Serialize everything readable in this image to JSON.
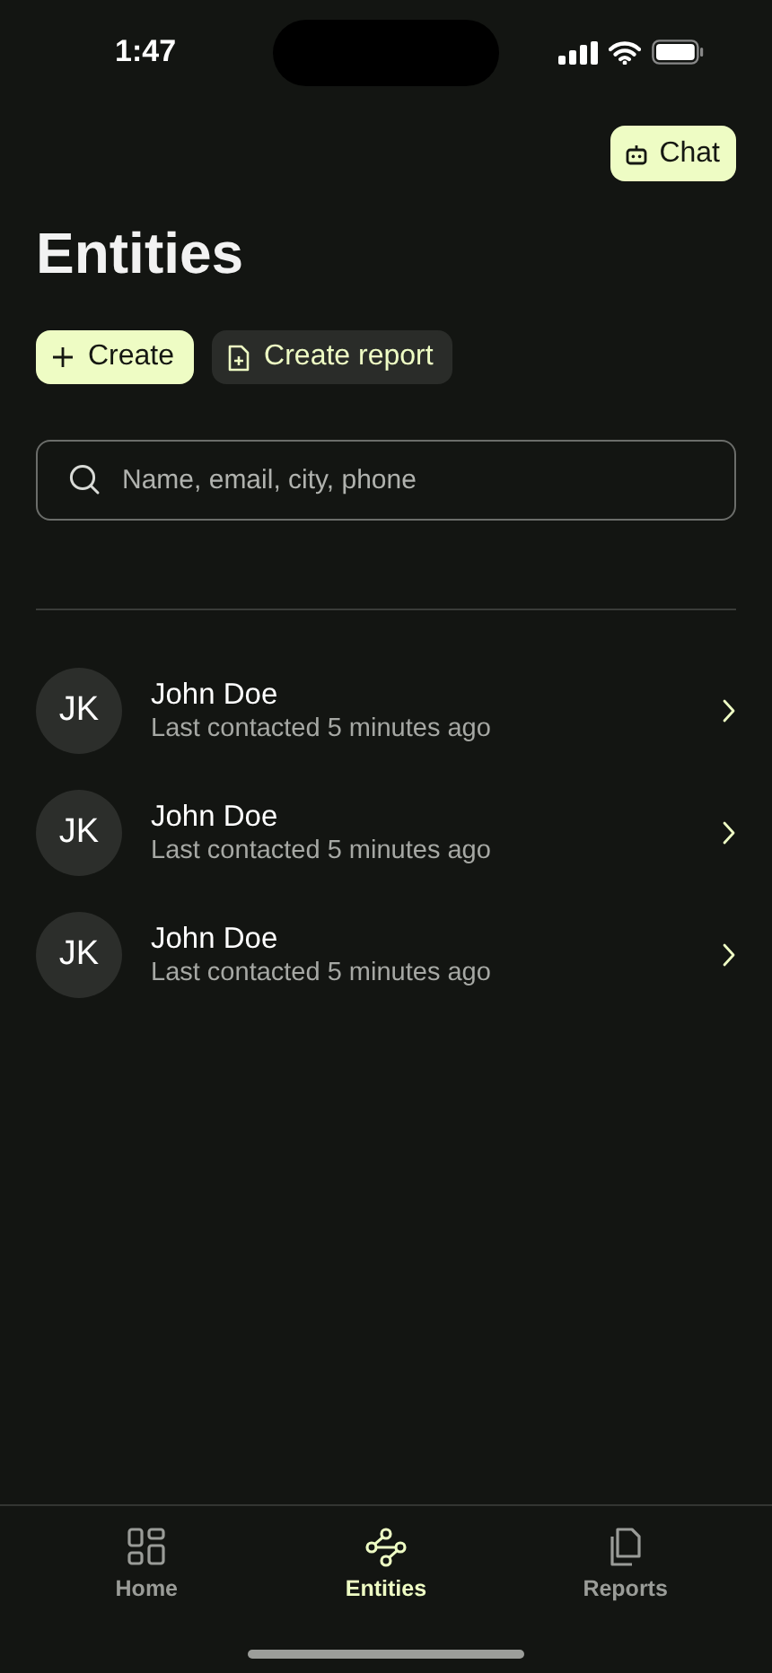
{
  "status_bar": {
    "time": "1:47"
  },
  "chat_button": {
    "label": "Chat"
  },
  "title": "Entities",
  "actions": [
    {
      "kind": "primary",
      "label": "Create"
    },
    {
      "kind": "secondary",
      "label": "Create report"
    }
  ],
  "search": {
    "placeholder": "Name, email, city, phone"
  },
  "entities": [
    {
      "initials": "JK",
      "name": "John Doe",
      "subtitle": "Last contacted 5 minutes ago"
    },
    {
      "initials": "JK",
      "name": "John Doe",
      "subtitle": "Last contacted 5 minutes ago"
    },
    {
      "initials": "JK",
      "name": "John Doe",
      "subtitle": "Last contacted 5 minutes ago"
    }
  ],
  "tab_bar": [
    {
      "kind": "home",
      "label": "Home",
      "selected": false
    },
    {
      "kind": "entities",
      "label": "Entities",
      "selected": true
    },
    {
      "kind": "reports",
      "label": "Reports",
      "selected": false
    }
  ]
}
